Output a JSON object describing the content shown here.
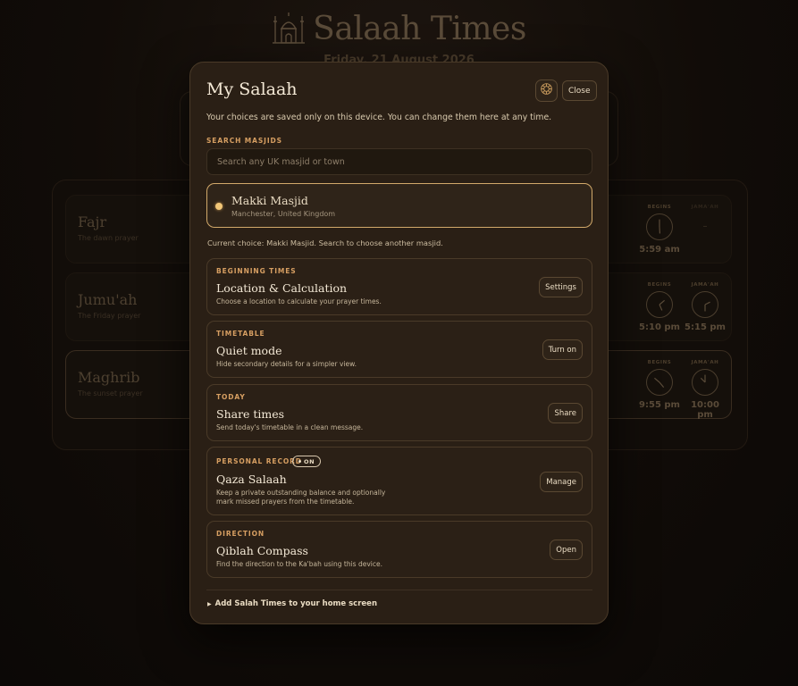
{
  "background": {
    "app_title": "Salaah Times",
    "date": "Friday, 21 August 2026",
    "prayers": [
      {
        "name": "Fajr",
        "subtitle": "The dawn prayer",
        "begins_label": "BEGINS",
        "jamaah_label": "JAMA'AH",
        "begins_time": "5:59 am",
        "jamaah_time": "–"
      },
      {
        "name": "Jumu'ah",
        "subtitle": "The Friday prayer",
        "begins_label": "BEGINS",
        "jamaah_label": "JAMA'AH",
        "begins_time": "5:10 pm",
        "jamaah_time": "5:15 pm"
      },
      {
        "name": "Maghrib",
        "subtitle": "The sunset prayer",
        "begins_label": "BEGINS",
        "jamaah_label": "JAMA'AH",
        "begins_time": "9:55 pm",
        "jamaah_time": "10:00 pm"
      }
    ]
  },
  "modal": {
    "title": "My Salaah",
    "icon_button": "theme-icon",
    "close_label": "Close",
    "intro": "Your choices are saved only on this device. You can change them here at any time.",
    "search": {
      "label": "SEARCH MASJIDS",
      "placeholder": "Search any UK masjid or town",
      "value": ""
    },
    "selected_masjid": {
      "name": "Makki Masjid",
      "location": "Manchester, United Kingdom"
    },
    "current_choice": "Current choice: Makki Masjid. Search to choose another masjid.",
    "cards": [
      {
        "label": "BEGINNING TIMES",
        "title": "Location & Calculation",
        "description": "Choose a location to calculate your prayer times.",
        "button": "Settings"
      },
      {
        "label": "TIMETABLE",
        "title": "Quiet mode",
        "description": "Hide secondary details for a simpler view.",
        "button": "Turn on"
      },
      {
        "label": "TODAY",
        "title": "Share times",
        "description": "Send today's timetable in a clean message.",
        "button": "Share"
      },
      {
        "label": "PERSONAL RECORD",
        "badge": "ON",
        "title": "Qaza Salaah",
        "description": "Keep a private outstanding balance and optionally mark missed prayers from the timetable.",
        "button": "Manage"
      },
      {
        "label": "DIRECTION",
        "title": "Qiblah Compass",
        "description": "Find the direction to the Ka'bah using this device.",
        "button": "Open"
      }
    ],
    "footer_link": "Add Salah Times to your home screen"
  },
  "colors": {
    "accent": "#d79f62",
    "modal_bg": "#2a1f15",
    "selected_border": "#d2a96a",
    "radio": "#f2c778"
  }
}
